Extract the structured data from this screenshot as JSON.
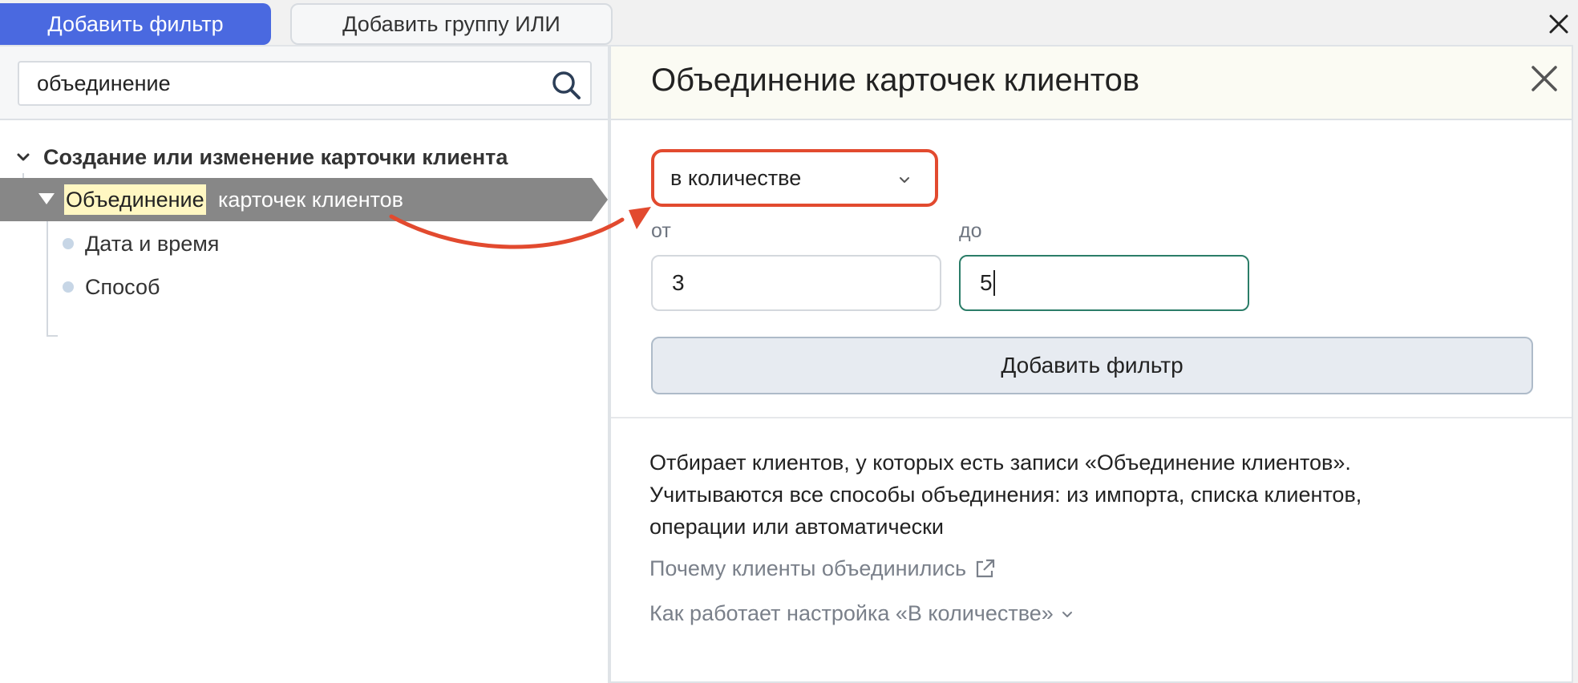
{
  "toolbar": {
    "add_filter": "Добавить фильтр",
    "add_or_group": "Добавить группу ИЛИ"
  },
  "search": {
    "value": "объединение"
  },
  "tree": {
    "root_label": "Создание или изменение карточки клиента",
    "selected_highlight": "Объединение",
    "selected_rest": "карточек клиентов",
    "children": [
      "Дата и время",
      "Способ"
    ]
  },
  "panel": {
    "title": "Объединение карточек клиентов",
    "select_value": "в количестве",
    "from_label": "от",
    "to_label": "до",
    "from_value": "3",
    "to_value": "5",
    "add_filter": "Добавить фильтр",
    "description": [
      "Отбирает клиентов, у которых есть записи «Объединение клиентов».",
      "Учитываются все способы объединения: из импорта, списка клиентов,",
      "операции или автоматически"
    ],
    "link_why": "Почему клиенты объединились",
    "link_howto": "Как работает настройка «В количестве»"
  },
  "colors": {
    "primary": "#4a69e0",
    "annotation": "#e24a2f",
    "selected_row": "#878787",
    "highlight": "#fff7c2",
    "focus": "#2b7d68"
  }
}
